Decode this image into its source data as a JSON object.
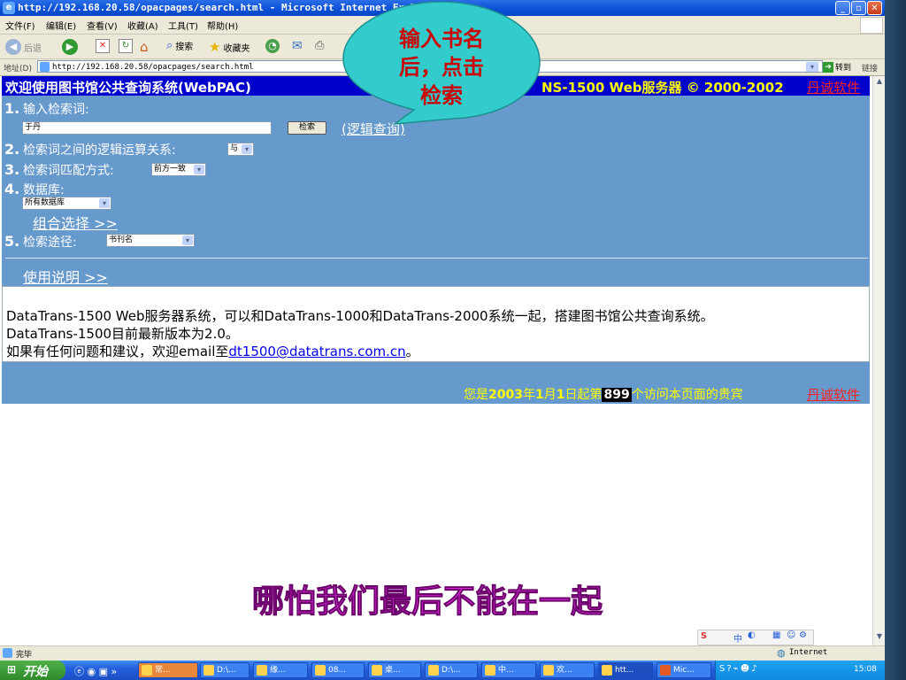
{
  "window": {
    "title": "http://192.168.20.58/opacpages/search.html - Microsoft Internet Explorer"
  },
  "menubar": [
    "文件(F)",
    "编辑(E)",
    "查看(V)",
    "收藏(A)",
    "工具(T)",
    "帮助(H)"
  ],
  "toolbar": {
    "back": "后退",
    "search": "搜索",
    "favorites": "收藏夹"
  },
  "address": {
    "label": "地址(D)",
    "url": "http://192.168.20.58/opacpages/search.html",
    "go": "转到",
    "links": "链接"
  },
  "page": {
    "header_left": "欢迎使用图书馆公共查询系统(WebPAC)",
    "header_right": "NS-1500 Web服务器 © 2000-2002",
    "brand": "丹诚软件",
    "step1_num": "1.",
    "step1_label": "输入检索词:",
    "search_value": "于丹",
    "search_button": "检索",
    "logic_query": "(逻辑查询)",
    "step2_num": "2.",
    "step2_label": "检索词之间的逻辑运算关系:",
    "step2_value": "与",
    "step3_num": "3.",
    "step3_label": "检索词匹配方式:",
    "step3_value": "前方一致",
    "step4_num": "4.",
    "step4_label": "数据库:",
    "step4_value": "所有数据库",
    "combine": "组合选择 >>",
    "step5_num": "5.",
    "step5_label": "检索途径:",
    "step5_value": "书刊名",
    "usage": "使用说明 >>",
    "info_line1": "DataTrans-1500 Web服务器系统，可以和DataTrans-1000和DataTrans-2000系统一起，搭建图书馆公共查询系统。",
    "info_line2": "DataTrans-1500目前最新版本为2.0。",
    "info_line3_prefix": "如果有任何问题和建议，欢迎email至",
    "info_email": "dt1500@datatrans.com.cn",
    "info_line3_suffix": "。",
    "visitor_prefix": "您是",
    "visitor_year": "2003",
    "visitor_mid1": "年",
    "visitor_month": "1",
    "visitor_mid2": "月",
    "visitor_day": "1",
    "visitor_mid3": "日起第",
    "visitor_count": "899",
    "visitor_suffix": "个访问本页面的贵宾"
  },
  "callout": {
    "line1": "输入书名",
    "line2": "后，点击",
    "line3": "检索"
  },
  "subtitle": "哪怕我们最后不能在一起",
  "status": {
    "left": "完毕",
    "zone": "Internet"
  },
  "taskbar": {
    "start": "开始",
    "tasks": [
      "常...",
      "D:\\...",
      "缘...",
      "08...",
      "桌...",
      "D:\\...",
      "中...",
      "欢...",
      "htt...",
      "Mic..."
    ],
    "clock": "15:08"
  },
  "sogou": "中"
}
